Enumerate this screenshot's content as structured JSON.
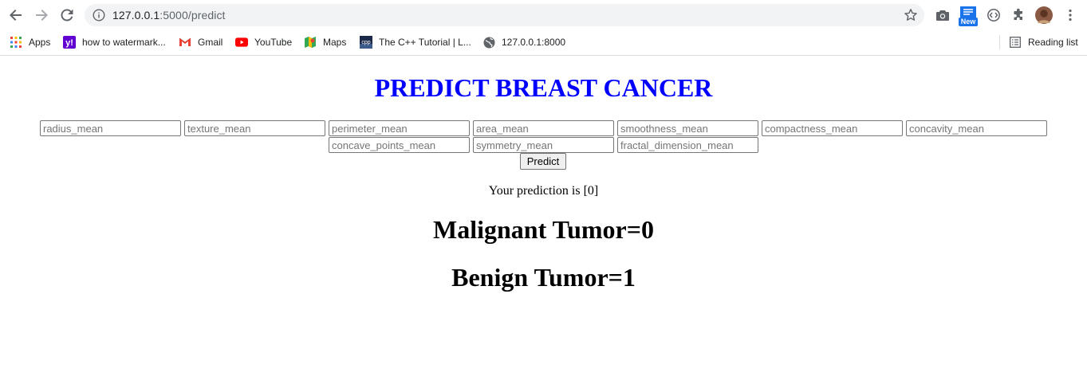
{
  "browser": {
    "url_host": "127.0.0.1",
    "url_path": ":5000/predict",
    "new_badge": "New",
    "bookmarks": [
      {
        "label": "Apps",
        "icon": "apps-grid-icon"
      },
      {
        "label": "how to watermark...",
        "icon": "yahoo-icon"
      },
      {
        "label": "Gmail",
        "icon": "gmail-icon"
      },
      {
        "label": "YouTube",
        "icon": "youtube-icon"
      },
      {
        "label": "Maps",
        "icon": "maps-icon"
      },
      {
        "label": "The C++ Tutorial | L...",
        "icon": "cpp-icon"
      },
      {
        "label": "127.0.0.1:8000",
        "icon": "globe-icon"
      }
    ],
    "reading_list": "Reading list"
  },
  "page": {
    "title": "PREDICT BREAST CANCER",
    "fields": [
      "radius_mean",
      "texture_mean",
      "perimeter_mean",
      "area_mean",
      "smoothness_mean",
      "compactness_mean",
      "concavity_mean",
      "concave_points_mean",
      "symmetry_mean",
      "fractal_dimension_mean"
    ],
    "predict_button": "Predict",
    "prediction_text": "Your prediction is [0]",
    "malignant_label": "Malignant Tumor=0",
    "benign_label": "Benign Tumor=1"
  },
  "colors": {
    "title": "#0000ff",
    "omnibox_bg": "#f1f3f4"
  }
}
